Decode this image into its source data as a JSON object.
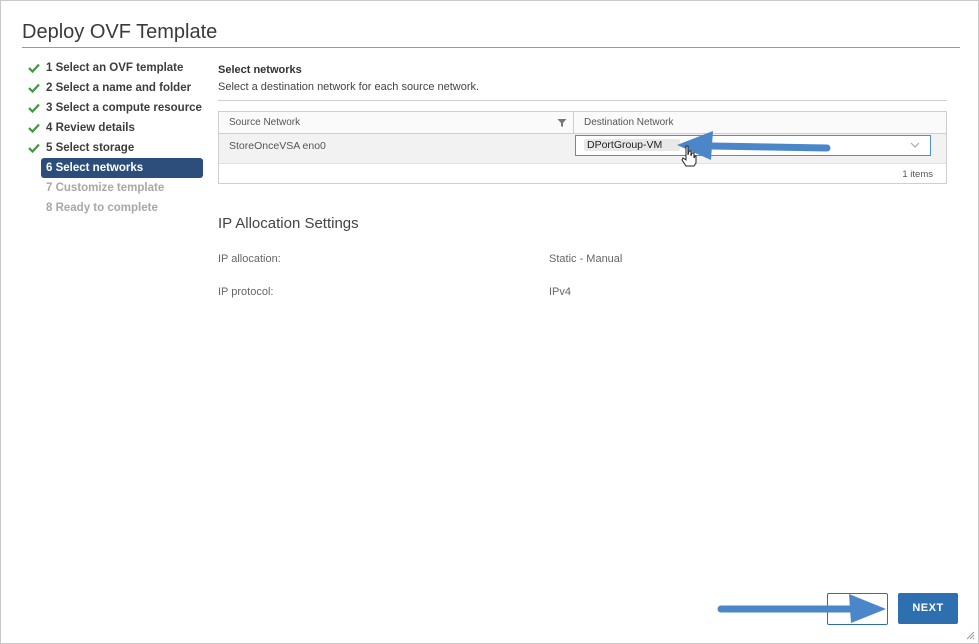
{
  "dialog": {
    "title": "Deploy OVF Template"
  },
  "steps": [
    {
      "label": "1 Select an OVF template",
      "state": "done"
    },
    {
      "label": "2 Select a name and folder",
      "state": "done"
    },
    {
      "label": "3 Select a compute resource",
      "state": "done"
    },
    {
      "label": "4 Review details",
      "state": "done"
    },
    {
      "label": "5 Select storage",
      "state": "done"
    },
    {
      "label": "6 Select networks",
      "state": "active"
    },
    {
      "label": "7 Customize template",
      "state": "disabled"
    },
    {
      "label": "8 Ready to complete",
      "state": "disabled"
    }
  ],
  "networks": {
    "title": "Select networks",
    "description": "Select a destination network for each source network.",
    "columns": {
      "source": "Source Network",
      "destination": "Destination Network"
    },
    "rows": [
      {
        "source": "StoreOnceVSA eno0",
        "destination": "DPortGroup-VM"
      }
    ],
    "footer": "1 items"
  },
  "ip_settings": {
    "title": "IP Allocation Settings",
    "allocation_label": "IP allocation:",
    "allocation_value": "Static - Manual",
    "protocol_label": "IP protocol:",
    "protocol_value": "IPv4"
  },
  "footer": {
    "next_label": "NEXT"
  },
  "colors": {
    "accent": "#2e6fb0",
    "active_step": "#2d4e7a",
    "check": "#3c9a3c",
    "arrow": "#4a86c8"
  }
}
